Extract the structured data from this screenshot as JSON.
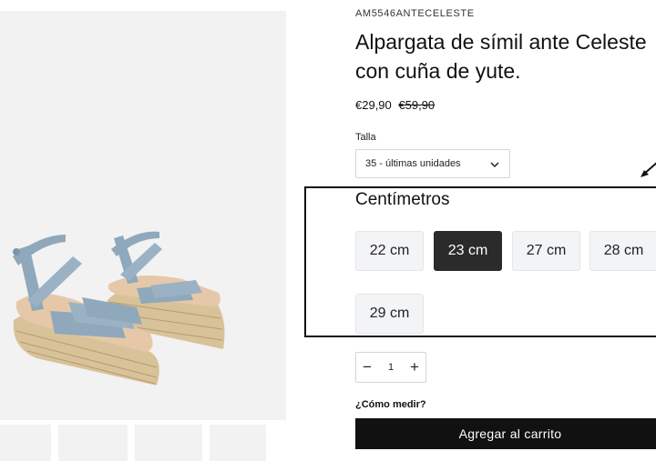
{
  "product": {
    "sku": "AM5546ANTECELESTE",
    "title_line1": "Alpargata de símil ante Celeste",
    "title_line2": "con cuña de yute.",
    "price_current": "€29,90",
    "price_original": "€59,90"
  },
  "size_select": {
    "label": "Talla",
    "value": "35 - últimas unidades"
  },
  "centimeters": {
    "heading": "Centímetros",
    "options": [
      "22 cm",
      "23 cm",
      "27 cm",
      "28 cm",
      "29 cm"
    ],
    "selected": "23 cm"
  },
  "quantity": {
    "minus": "−",
    "value": "1",
    "plus": "+"
  },
  "how_to_measure": "¿Cómo medir?",
  "add_to_cart": "Agregar al carrito",
  "colors": {
    "accent": "#111111",
    "shoe_strap": "#8fa8bb",
    "jute": "#d8c29a",
    "selected_bg": "#2b2b2b"
  }
}
